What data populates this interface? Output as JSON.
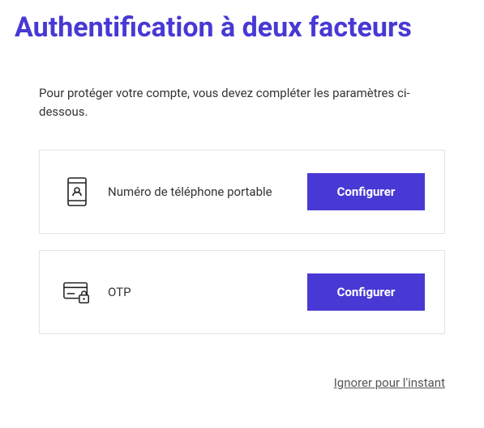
{
  "title": "Authentification à deux facteurs",
  "intro": "Pour protéger votre compte, vous devez compléter les paramètres ci-dessous.",
  "methods": {
    "phone": {
      "label": "Numéro de téléphone portable",
      "button": "Configurer"
    },
    "otp": {
      "label": "OTP",
      "button": "Configurer"
    }
  },
  "skip": "Ignorer pour l'instant"
}
